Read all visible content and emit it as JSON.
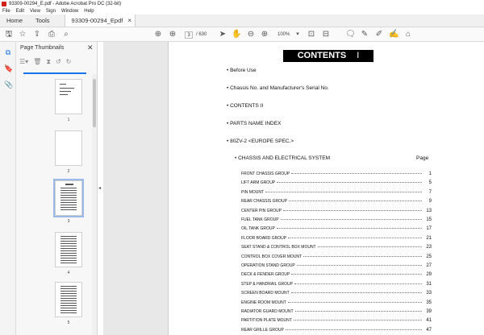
{
  "window": {
    "title": "93309-00294_E.pdf - Adobe Acrobat Pro DC (32-bit)"
  },
  "menu": [
    "File",
    "Edit",
    "View",
    "Sign",
    "Window",
    "Help"
  ],
  "tabs": {
    "home": "Home",
    "tools": "Tools",
    "document": "93309-00294_Epdf"
  },
  "toolbar": {
    "current_page": "3",
    "total_pages": "/ 630",
    "zoom": "100%"
  },
  "panel": {
    "title": "Page Thumbnails",
    "thumbnails": [
      "1",
      "2",
      "3",
      "4",
      "5"
    ]
  },
  "document": {
    "heading": "CONTENTS",
    "cursor": "I",
    "bullets": [
      "• Before Use",
      "• Chassis No. and Manufacturer's Serial No.",
      "• CONTENTS II",
      "• PARTS NAME INDEX",
      "• 80ZV-2 <EUROPE SPEC.>"
    ],
    "section": {
      "title": "• CHASSIS AND ELECTRICAL SYSTEM",
      "page_header": "Page"
    },
    "toc": [
      {
        "name": "FRONT CHASSIS GROUP",
        "page": "1"
      },
      {
        "name": "LIFT ARM GROUP",
        "page": "5"
      },
      {
        "name": "PIN MOUNT",
        "page": "7"
      },
      {
        "name": "REAR CHASSIS GROUP",
        "page": "9"
      },
      {
        "name": "CENTER PIN GROUP",
        "page": "13"
      },
      {
        "name": "FUEL TANK GROUP",
        "page": "15"
      },
      {
        "name": "OIL TANK GROUP",
        "page": "17"
      },
      {
        "name": "FLOOR BOARD GROUP",
        "page": "21"
      },
      {
        "name": "SEAT STAND & CONTROL BOX MOUNT",
        "page": "23"
      },
      {
        "name": "CONTROL BOX COVER MOUNT",
        "page": "25"
      },
      {
        "name": "OPERATION STAND GROUP",
        "page": "27"
      },
      {
        "name": "DECK & FENDER GROUP",
        "page": "29"
      },
      {
        "name": "STEP & HANDRAIL GROUP",
        "page": "31"
      },
      {
        "name": "SCREEN BOARD MOUNT",
        "page": "33"
      },
      {
        "name": "ENGINE ROOM MOUNT",
        "page": "35"
      },
      {
        "name": "RADIATOR GUARD MOUNT",
        "page": "39"
      },
      {
        "name": "PARTITION PLATE MOUNT",
        "page": "41"
      },
      {
        "name": "REAR GRILLE GROUP",
        "page": "47"
      }
    ]
  }
}
